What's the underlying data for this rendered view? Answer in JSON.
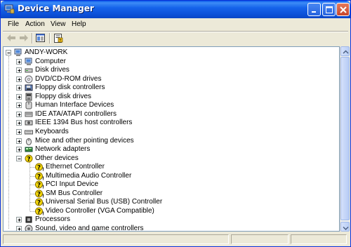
{
  "window": {
    "title": "Device Manager",
    "icon": "device-manager-icon",
    "controls": [
      "minimize-icon",
      "maximize-icon",
      "close-icon"
    ]
  },
  "menu": {
    "items": [
      "File",
      "Action",
      "View",
      "Help"
    ]
  },
  "toolbar": {
    "buttons": [
      "back-arrow-icon",
      "forward-arrow-icon",
      "show-hide-console-tree-icon",
      "properties-icon"
    ]
  },
  "tree": {
    "root": {
      "label": "ANDY-WORK",
      "icon": "computer-icon",
      "expanded": true
    },
    "items": [
      {
        "label": "Computer",
        "icon": "computer-icon",
        "expanded": false
      },
      {
        "label": "Disk drives",
        "icon": "disk-drive-icon",
        "expanded": false
      },
      {
        "label": "DVD/CD-ROM drives",
        "icon": "cdrom-icon",
        "expanded": false
      },
      {
        "label": "Floppy disk controllers",
        "icon": "floppy-controller-icon",
        "expanded": false
      },
      {
        "label": "Floppy disk drives",
        "icon": "floppy-drive-icon",
        "expanded": false
      },
      {
        "label": "Human Interface Devices",
        "icon": "hid-icon",
        "expanded": false
      },
      {
        "label": "IDE ATA/ATAPI controllers",
        "icon": "ide-controller-icon",
        "expanded": false
      },
      {
        "label": "IEEE 1394 Bus host controllers",
        "icon": "ieee1394-icon",
        "expanded": false
      },
      {
        "label": "Keyboards",
        "icon": "keyboard-icon",
        "expanded": false
      },
      {
        "label": "Mice and other pointing devices",
        "icon": "mouse-icon",
        "expanded": false
      },
      {
        "label": "Network adapters",
        "icon": "network-adapter-icon",
        "expanded": false
      },
      {
        "label": "Other devices",
        "icon": "unknown-device-icon",
        "expanded": true,
        "children": [
          {
            "label": "Ethernet Controller",
            "icon": "unknown-device-warning-icon"
          },
          {
            "label": "Multimedia Audio Controller",
            "icon": "unknown-device-warning-icon"
          },
          {
            "label": "PCI Input Device",
            "icon": "unknown-device-warning-icon"
          },
          {
            "label": "SM Bus Controller",
            "icon": "unknown-device-warning-icon"
          },
          {
            "label": "Universal Serial Bus (USB) Controller",
            "icon": "unknown-device-warning-icon"
          },
          {
            "label": "Video Controller (VGA Compatible)",
            "icon": "unknown-device-warning-icon"
          }
        ]
      },
      {
        "label": "Processors",
        "icon": "processor-icon",
        "expanded": false
      },
      {
        "label": "Sound, video and game controllers",
        "icon": "sound-icon",
        "expanded": false
      }
    ]
  },
  "colors": {
    "titlebar": "#0a58e8",
    "window_face": "#ece9d8",
    "warning": "#f5d90a"
  }
}
